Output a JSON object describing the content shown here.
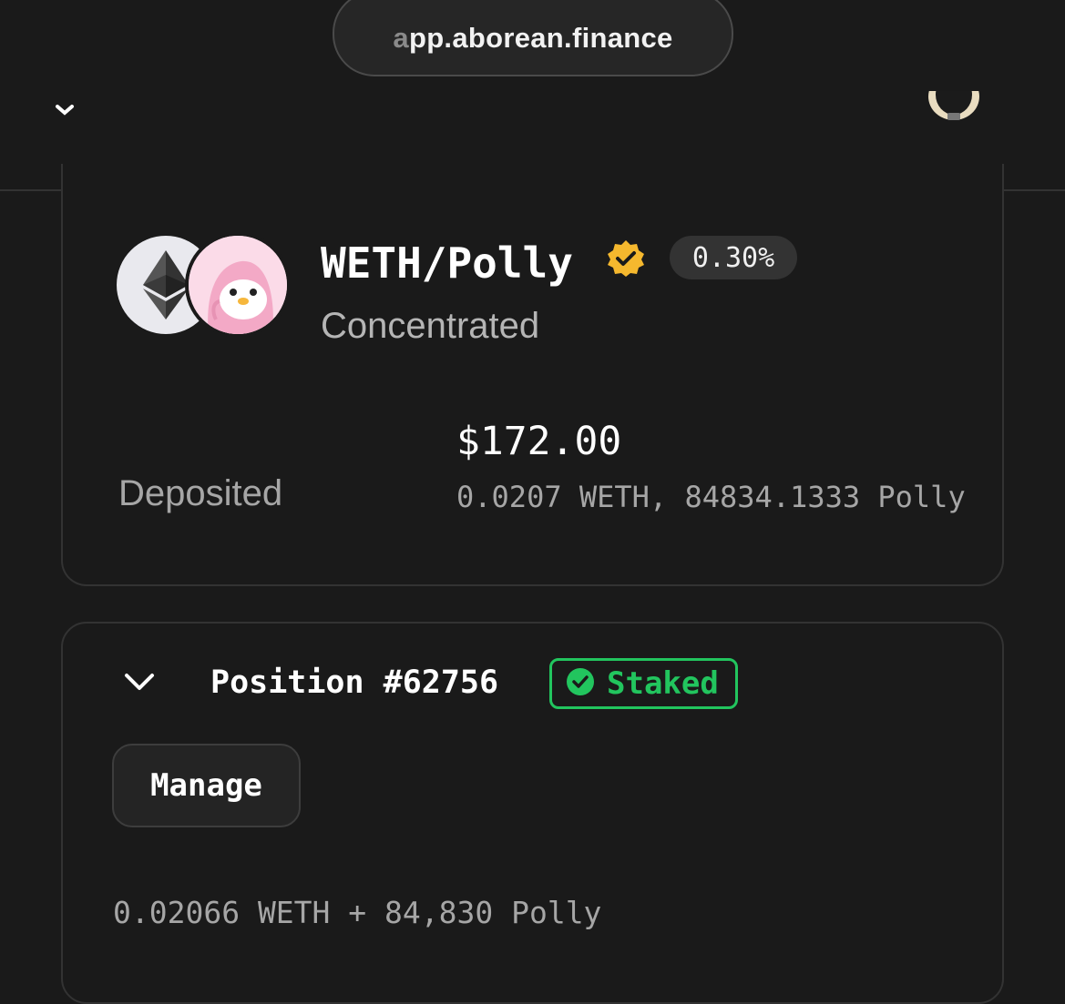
{
  "browser": {
    "url": "app.aborean.finance"
  },
  "pool": {
    "pair": "WETH/Polly",
    "fee": "0.30%",
    "type": "Concentrated",
    "token0_icon": "ethereum-icon",
    "token1_icon": "polly-penguin-icon",
    "verified_icon": "verified-badge-icon"
  },
  "deposited": {
    "label": "Deposited",
    "usd": "$172.00",
    "amounts": "0.0207 WETH, 84834.1333 Polly"
  },
  "position": {
    "title": "Position #62756",
    "status": "Staked",
    "status_color": "#22c55e",
    "manage_label": "Manage",
    "amounts": "0.02066 WETH + 84,830 Polly"
  }
}
